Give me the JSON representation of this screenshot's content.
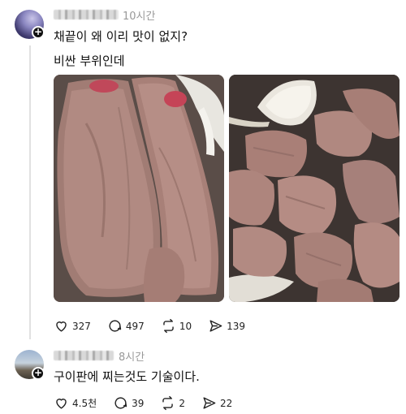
{
  "post": {
    "time": "10시간",
    "text_line1": "채끝이 왜 이리 맛이 없지?",
    "text_line2": "비싼 부위인데",
    "likes": "327",
    "comments": "497",
    "reposts": "10",
    "shares": "139"
  },
  "reply": {
    "time": "8시간",
    "text": "구이판에 찌는것도 기술이다.",
    "likes": "4.5천",
    "comments": "39",
    "reposts": "2",
    "shares": "22"
  },
  "icons": {
    "like": "heart-icon",
    "comment": "comment-icon",
    "repost": "repost-icon",
    "share": "share-icon",
    "follow": "plus-icon"
  },
  "colors": {
    "text": "#111111",
    "muted": "#999999",
    "thread_line": "#e1e1e1"
  }
}
